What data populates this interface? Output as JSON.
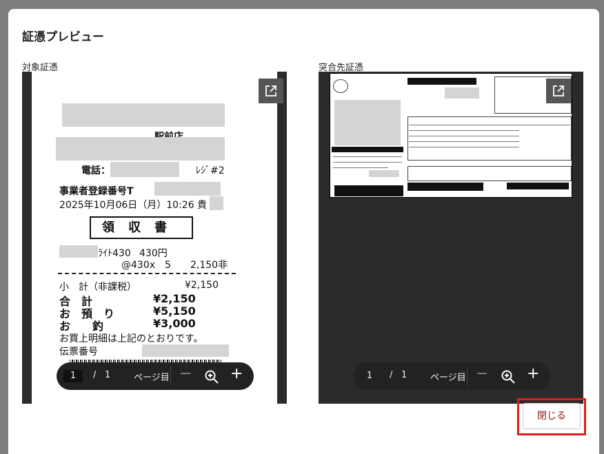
{
  "modal": {
    "title": "証憑プレビュー",
    "left_label": "対象証憑",
    "right_label": "突合先証憑",
    "close_label": "閉じる"
  },
  "receipt": {
    "store": "駅前店",
    "phone": "電話：",
    "register": "ﾚｼﾞ#2",
    "reg_no": "事業者登録番号T",
    "datetime": "2025年10月06日（月）10:26 貴",
    "title": "領収書",
    "item": "ﾗｲﾄ430",
    "item_price": "430円",
    "qty": "@430x　5",
    "qty_total": "2,150非",
    "subtotal_label": "小　計（非課税）",
    "subtotal": "¥2,150",
    "total_label": "合　計",
    "total": "¥2,150",
    "deposit_label": "お　預　り",
    "deposit": "¥5,150",
    "change_label": "お　　釣",
    "change": "¥3,000",
    "note": "お買上明細は上記のとおりです。",
    "slip_label": "伝票番号"
  },
  "pager_left": {
    "current": "1",
    "slash": "/",
    "total": "1",
    "unit": "ページ目",
    "minus": "−",
    "plus": "+"
  },
  "pager_right": {
    "current": "1",
    "slash": "/",
    "total": "1",
    "unit": "ページ目",
    "minus": "−",
    "plus": "+"
  },
  "colors": {
    "accent": "#8b1a1a",
    "highlight": "#e01c1c",
    "viewer_bg": "#2b2b2b"
  }
}
